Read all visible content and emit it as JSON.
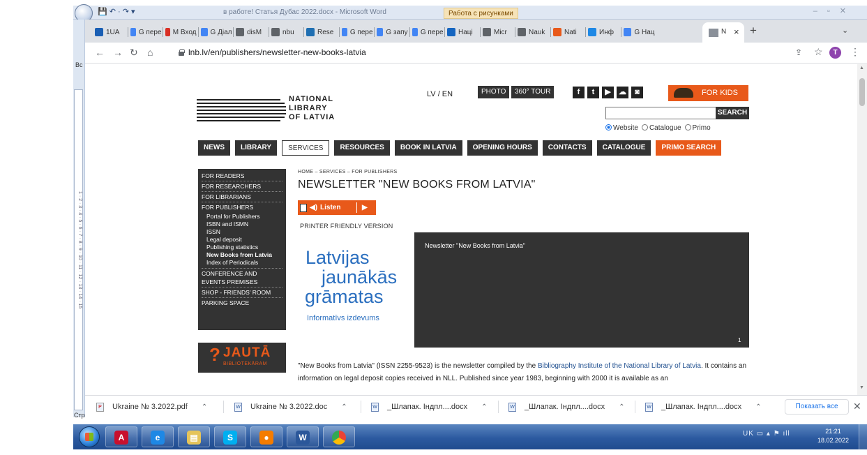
{
  "word": {
    "title": "в работе! Статья Дубас 2022.docx - Microsoft Word",
    "context_tab": "Работа с рисунками",
    "left_label_top": "Вс",
    "left_label_bottom": "Стр",
    "ruler_marks": "1 · 2 · 3 · 4 · 5 · 6 · 7 · 8 · 9 · 10 · 11 · 12 · 13 · 14 · 15"
  },
  "browser": {
    "tabs": [
      {
        "label": "1UA",
        "icon": "1ua-icon",
        "color": "#1a5fb4"
      },
      {
        "label": "G пере",
        "icon": "google-icon",
        "color": "#4285f4"
      },
      {
        "label": "M Вход",
        "icon": "gmail-icon",
        "color": "#d93025"
      },
      {
        "label": "G Діал",
        "icon": "google-icon",
        "color": "#4285f4"
      },
      {
        "label": "disM",
        "icon": "globe-icon",
        "color": "#5f6368"
      },
      {
        "label": "nbu",
        "icon": "globe-icon",
        "color": "#5f6368"
      },
      {
        "label": "Rese",
        "icon": "researchgate-icon",
        "color": "#1f6fb2"
      },
      {
        "label": "G пере",
        "icon": "google-icon",
        "color": "#4285f4"
      },
      {
        "label": "G запу",
        "icon": "google-icon",
        "color": "#4285f4"
      },
      {
        "label": "G пере",
        "icon": "google-icon",
        "color": "#4285f4"
      },
      {
        "label": "Наці",
        "icon": "library-icon",
        "color": "#1565c0"
      },
      {
        "label": "Micr",
        "icon": "globe-icon",
        "color": "#5f6368"
      },
      {
        "label": "Nauk",
        "icon": "globe-icon",
        "color": "#5f6368"
      },
      {
        "label": "Nati",
        "icon": "nati-icon",
        "color": "#e8591a"
      },
      {
        "label": "Инф",
        "icon": "diamond-icon",
        "color": "#1e88e5"
      },
      {
        "label": "G Нац",
        "icon": "google-icon",
        "color": "#4285f4"
      }
    ],
    "active_tab_label": "N",
    "url": "lnb.lv/en/publishers/newsletter-new-books-latvia",
    "avatar_letter": "T"
  },
  "page": {
    "logo_text": [
      "NATIONAL",
      "LIBRARY",
      "OF LATVIA"
    ],
    "lang": "LV / EN",
    "photo_btn": "PHOTO",
    "tour_btn": "360° TOUR",
    "social_icons": [
      "facebook-icon",
      "twitter-icon",
      "youtube-icon",
      "cloud-icon",
      "instagram-icon"
    ],
    "for_kids": "FOR KIDS",
    "search_btn": "SEARCH",
    "search_options": [
      "Website",
      "Catalogue",
      "Primo"
    ],
    "nav": [
      "NEWS",
      "LIBRARY",
      "SERVICES",
      "RESOURCES",
      "BOOK IN LATVIA",
      "OPENING HOURS",
      "CONTACTS",
      "CATALOGUE",
      "PRIMO SEARCH"
    ],
    "side_sections": {
      "readers": "FOR READERS",
      "researchers": "FOR RESEARCHERS",
      "librarians": "FOR LIBRARIANS",
      "publishers": "FOR PUBLISHERS",
      "publisher_items": [
        "Portal for Publishers",
        "ISBN and ISMN",
        "ISSN",
        "Legal deposit",
        "Publishing statistics",
        "New Books from Latvia",
        "Index of Periodicals"
      ],
      "conference_1": "CONFERENCE AND",
      "conference_2": "EVENTS PREMISES",
      "shop": "SHOP - FRIENDS' ROOM",
      "parking": "PARKING SPACE"
    },
    "ask": {
      "q": "?",
      "title": "JAUTĀ",
      "sub": "BIBLIOTEKĀRAM"
    },
    "breadcrumb": "HOME – SERVICES – FOR PUBLISHERS",
    "title": "NEWSLETTER \"NEW BOOKS FROM LATVIA\"",
    "listen": "Listen",
    "printer": "PRINTER FRIENDLY VERSION",
    "promo": [
      "Latvijas",
      "jaunākās",
      "grāmatas",
      "Informatīvs izdevums"
    ],
    "video_title": "Newsletter \"New Books from Latvia\"",
    "video_num": "1",
    "desc_1": "\"New Books from Latvia\" (ISSN 2255-9523) is the newsletter compiled by the ",
    "desc_link": "Bibliography Institute of the National Library of Latvia",
    "desc_2": ". It contains an information on legal deposit copies received in NLL. Published since year 1983, beginning with 2000 it is available as an"
  },
  "downloads": {
    "items": [
      "Ukraine № 3.2022.pdf",
      "Ukraine № 3.2022.doc",
      "_Шлапак. Індпл....docx",
      "_Шлапак. Індпл....docx",
      "_Шлапак. Індпл....docx"
    ],
    "show_all": "Показать все"
  },
  "taskbar": {
    "lang": "UK",
    "time": "21:21",
    "date": "18.02.2022"
  }
}
